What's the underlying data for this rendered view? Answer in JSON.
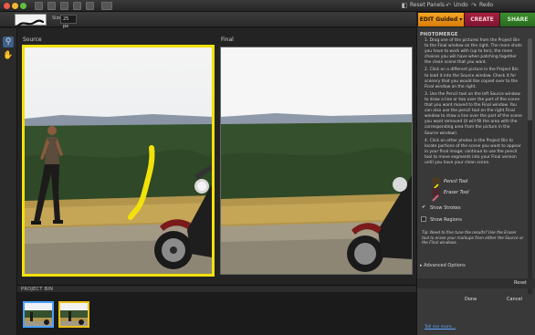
{
  "topbar": {
    "reset_panels": "Reset Panels",
    "undo": "Undo",
    "redo": "Redo"
  },
  "options": {
    "size_label": "Size:",
    "size_value": "25 px"
  },
  "modes": {
    "edit": "EDIT Guided",
    "create": "CREATE",
    "share": "SHARE"
  },
  "workspace": {
    "source_label": "Source",
    "final_label": "Final"
  },
  "project_bin": {
    "title": "PROJECT BIN"
  },
  "panel": {
    "title": "PHOTOMERGE",
    "steps": [
      "1. Drag one of the pictures from the Project Bin to the Final window on the right. The more shots you have to work with (up to ten), the more choices you will have when patching together the clean scene that you want.",
      "2. Click on a different picture in the Project Bin to load it into the Source window. Check it for scenery that you would like copied over to the Final window on the right.",
      "3. Use the Pencil tool on the left Source window to draw a line or two over the part of the scene that you want moved to the Final window. You can also use the pencil tool on the right Final window to draw a line over the part of the scene you want removed (it will fill the area with the corresponding area from the picture in the Source window).",
      "4. Click on other photos in the Project Bin to locate portions of the scene you want to appear in your final image; continue to use the pencil tool to move segments into your Final version until you have your clean scene."
    ],
    "pencil_tool": "Pencil Tool",
    "eraser_tool": "Eraser Tool",
    "show_strokes": "Show Strokes",
    "show_regions": "Show Regions",
    "tip": "Tip: Need to fine tune the results? Use the Eraser tool to erase your markups from either the Source or the Final windows.",
    "advanced_options": "Advanced Options",
    "reset": "Reset",
    "done": "Done",
    "cancel": "Cancel",
    "tell_more": "Tell me more..."
  },
  "colors": {
    "edit_tab": "#f5a623",
    "create_tab": "#a81f3e",
    "share_tab": "#3c8c2e",
    "stroke": "#f2e10b",
    "link": "#5ea6ff"
  }
}
